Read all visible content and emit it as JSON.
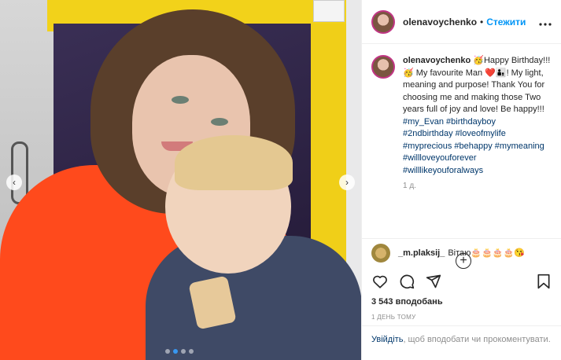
{
  "photo": {
    "prev_arrow": "‹",
    "next_arrow": "›",
    "slide_count": 4,
    "active_slide": 2
  },
  "header": {
    "username": "olenavoychenko",
    "separator": "•",
    "follow_label": "Стежити",
    "more_icon": "ellipsis-icon"
  },
  "caption": {
    "username": "olenavoychenko",
    "text": "🥳Happy Birthday!!! 🥳 My favourite Man ❤️👨‍👦! My light, meaning and purpose! Thank You for choosing me and making those Two years full of joy and love! Be happy!!!",
    "hashtags": [
      "#my_Evan",
      "#birthdayboy",
      "#2ndbirthday",
      "#loveofmylife",
      "#myprecious",
      "#behappy",
      "#mymeaning",
      "#willloveyouforever",
      "#willlikeyouforalways"
    ],
    "age": "1 д."
  },
  "load_more_symbol": "+",
  "comment": {
    "username": "_m.plaksij_",
    "text": "Вітаю🎂🎂🎂🎂😘"
  },
  "stats": {
    "likes": "3 543 вподобань",
    "timestamp": "1 ДЕНЬ ТОМУ"
  },
  "login": {
    "link": "Увійдіть",
    "text": ", щоб вподобати чи прокоментувати."
  },
  "colors": {
    "accent": "#0095f6",
    "hashtag": "#00376b",
    "muted": "#8e8e8e",
    "story_ring": "#c13584"
  }
}
